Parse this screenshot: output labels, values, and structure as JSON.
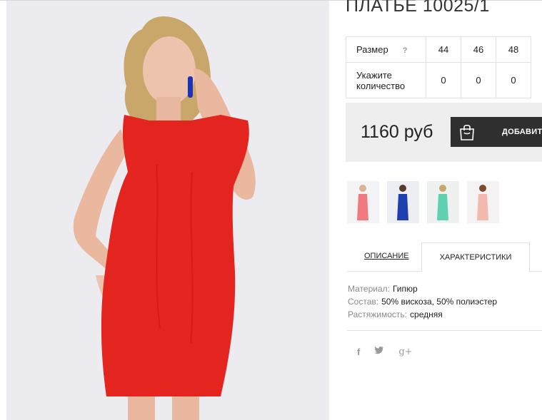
{
  "product": {
    "title": "ПЛАТЬЕ 10025/1",
    "image_alt": "red-lace-dress-model-photo"
  },
  "sizes": {
    "size_label": "Размер",
    "help_mark": "?",
    "values": [
      "44",
      "46",
      "48"
    ],
    "qty_label_line1": "Укажите",
    "qty_label_line2": "количество",
    "quantities": [
      "0",
      "0",
      "0"
    ]
  },
  "purchase": {
    "price": "1160 руб",
    "add_to_cart_label": "ДОБАВИТЬ",
    "button_icon": "shopping-bag-icon"
  },
  "thumbnails": [
    {
      "name": "pink-dress",
      "color": "#f07a80"
    },
    {
      "name": "blue-dress",
      "color": "#1f3fb0"
    },
    {
      "name": "mint-dress",
      "color": "#5fd1b0"
    },
    {
      "name": "peach-dress",
      "color": "#f4b9ad"
    }
  ],
  "tabs": {
    "description": "ОПИСАНИЕ",
    "characteristics": "ХАРАКТЕРИСТИКИ"
  },
  "specs": [
    {
      "key": "Материал:",
      "value": "Гипюр"
    },
    {
      "key": "Состав:",
      "value": "50% вискоза, 50% полиэстер"
    },
    {
      "key": "Растяжимость:",
      "value": "средняя"
    }
  ],
  "social": {
    "facebook": "f",
    "twitter_icon": "twitter-icon",
    "google_plus": "g+"
  },
  "colors": {
    "dress_red": "#e4241e",
    "button_dark": "#2f2f2f",
    "price_bg": "#eeeeee",
    "border": "#e2e2e2"
  }
}
